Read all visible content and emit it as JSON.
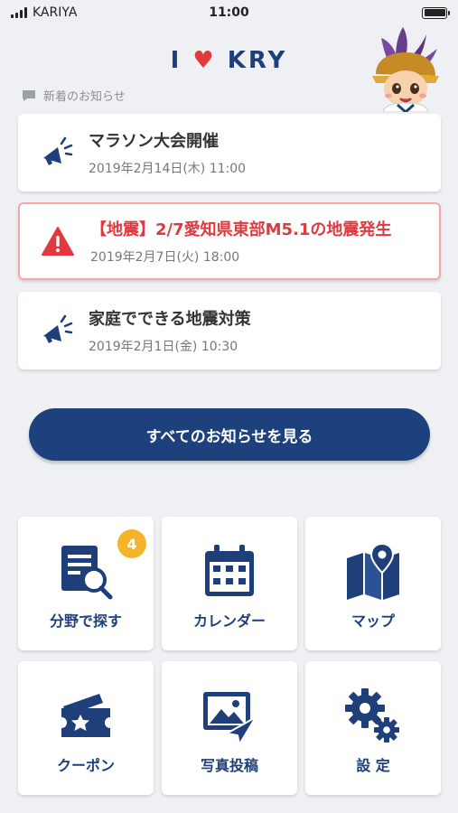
{
  "status_bar": {
    "carrier": "KARIYA",
    "time": "11:00"
  },
  "header": {
    "logo_left": "I",
    "logo_right": "KRY"
  },
  "news_section": {
    "heading": "新着のお知らせ",
    "items": [
      {
        "icon": "megaphone-icon",
        "title": "マラソン大会開催",
        "date": "2019年2月14日(木) 11:00",
        "alert": false
      },
      {
        "icon": "warning-icon",
        "title": "【地震】2/7愛知県東部M5.1の地震発生",
        "date": "2019年2月7日(火) 18:00",
        "alert": true
      },
      {
        "icon": "megaphone-icon",
        "title": "家庭でできる地震対策",
        "date": "2019年2月1日(金) 10:30",
        "alert": false
      }
    ],
    "all_button_label": "すべてのお知らせを見る"
  },
  "menu": {
    "tiles": [
      {
        "icon": "document-search-icon",
        "label": "分野で探す",
        "badge": "4"
      },
      {
        "icon": "calendar-icon",
        "label": "カレンダー"
      },
      {
        "icon": "map-icon",
        "label": "マップ"
      },
      {
        "icon": "coupon-icon",
        "label": "クーポン"
      },
      {
        "icon": "photo-post-icon",
        "label": "写真投稿"
      },
      {
        "icon": "gear-icon",
        "label": "設 定"
      }
    ]
  },
  "colors": {
    "brand_navy": "#1d417c",
    "alert_red": "#e0393e",
    "badge_yellow": "#f4b42a",
    "heart_red": "#e03a3a"
  }
}
